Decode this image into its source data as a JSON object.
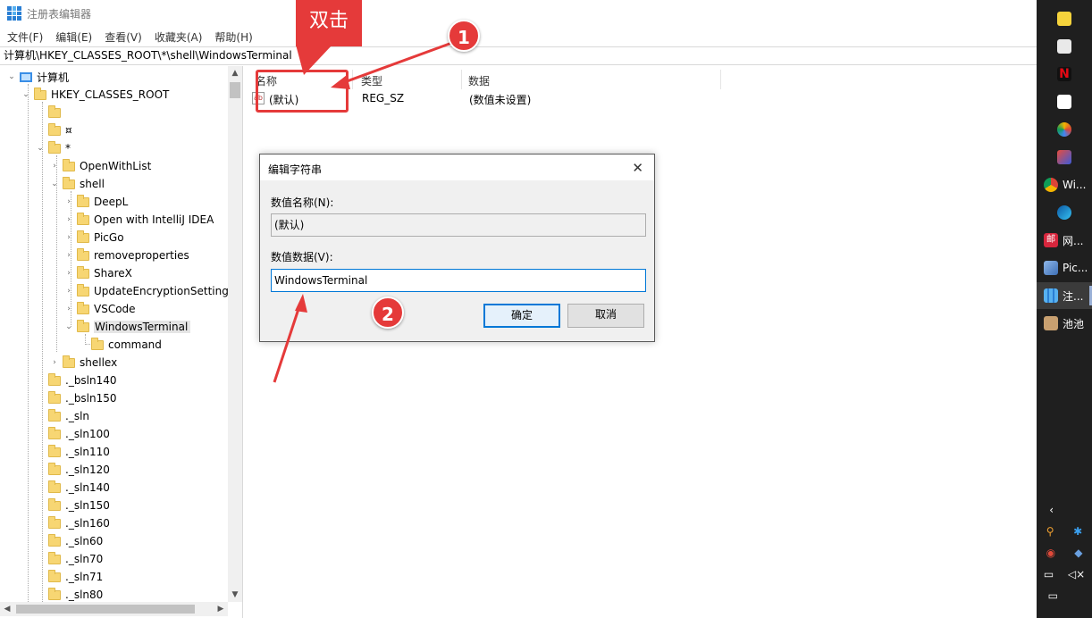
{
  "window": {
    "title": "注册表编辑器"
  },
  "menu": [
    "文件(F)",
    "编辑(E)",
    "查看(V)",
    "收藏夹(A)",
    "帮助(H)"
  ],
  "address": "计算机\\HKEY_CLASSES_ROOT\\*\\shell\\WindowsTerminal",
  "tree": {
    "computer": "计算机",
    "hkcr": "HKEY_CLASSES_ROOT",
    "blank1": "",
    "blank2": "¤",
    "star": "*",
    "openwithlist": "OpenWithList",
    "shell": "shell",
    "shell_children": [
      "DeepL",
      "Open with IntelliJ IDEA",
      "PicGo",
      "removeproperties",
      "ShareX",
      "UpdateEncryptionSettings",
      "VSCode",
      "WindowsTerminal"
    ],
    "command": "command",
    "shellex": "shellex",
    "extensions": [
      "._bsln140",
      "._bsln150",
      "._sln",
      "._sln100",
      "._sln110",
      "._sln120",
      "._sln140",
      "._sln150",
      "._sln160",
      "._sln60",
      "._sln70",
      "._sln71",
      "._sln80"
    ]
  },
  "list": {
    "headers": {
      "name": "名称",
      "type": "类型",
      "data": "数据"
    },
    "row": {
      "name": "(默认)",
      "type": "REG_SZ",
      "data": "(数值未设置)"
    }
  },
  "dialog": {
    "title": "编辑字符串",
    "name_label": "数值名称(N):",
    "name_value": "(默认)",
    "data_label": "数值数据(V):",
    "data_value": "WindowsTerminal",
    "ok": "确定",
    "cancel": "取消"
  },
  "annotation": {
    "callout": "双击",
    "step1": "1",
    "step2": "2",
    "color": "#e53a3a"
  },
  "taskbar": {
    "items": [
      {
        "icon": "sticky-notes-icon",
        "label": ""
      },
      {
        "icon": "store-icon",
        "label": ""
      },
      {
        "icon": "netflix-icon",
        "label": ""
      },
      {
        "icon": "note-icon",
        "label": ""
      },
      {
        "icon": "edge-canary-icon",
        "label": ""
      },
      {
        "icon": "app-icon",
        "label": ""
      },
      {
        "icon": "chrome-icon",
        "label": "Wi..."
      },
      {
        "icon": "edge-icon",
        "label": ""
      },
      {
        "icon": "netease-mail-icon",
        "label": "网..."
      },
      {
        "icon": "picture-icon",
        "label": "Pic..."
      },
      {
        "icon": "regedit-icon",
        "label": "注..."
      },
      {
        "icon": "avatar-icon",
        "label": "池池"
      }
    ]
  }
}
